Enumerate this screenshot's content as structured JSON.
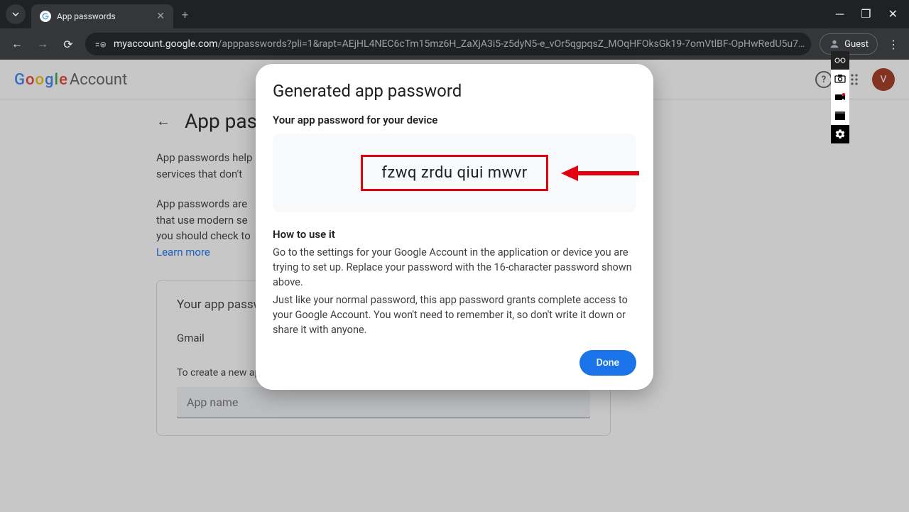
{
  "browser": {
    "tab_title": "App passwords",
    "url_display_prefix": "myaccount.google.com",
    "url_display_rest": "/apppasswords?pli=1&rapt=AEjHL4NEC6cTm15mz6H_ZaXjA3i5-z5dyN5-e_vOr5qgpqsZ_MOqHFOksGk19-7omVtlBF-OpHwRedU5u7…",
    "guest_label": "Guest"
  },
  "header": {
    "logo_g": "G",
    "logo_o1": "o",
    "logo_o2": "o",
    "logo_g2": "g",
    "logo_l": "l",
    "logo_e": "e",
    "logo_account": "Account",
    "avatar_letter": "V"
  },
  "page": {
    "title": "App passwords",
    "para1": "App passwords help",
    "para1b": "services that don't",
    "para2": "App passwords are",
    "para2b": "that use modern se",
    "para2c": "you should check to",
    "learn_more": "Learn more",
    "card_heading": "Your app passw",
    "card_item": "Gmail",
    "create_hint": "To create a new ap",
    "input_placeholder": "App name"
  },
  "modal": {
    "title": "Generated app password",
    "subtitle": "Your app password for your device",
    "password": "fzwq zrdu qiui mwvr",
    "how_heading": "How to use it",
    "how_p1": "Go to the settings for your Google Account in the application or device you are trying to set up. Replace your password with the 16-character password shown above.",
    "how_p2": "Just like your normal password, this app password grants complete access to your Google Account. You won't need to remember it, so don't write it down or share it with anyone.",
    "done": "Done"
  }
}
